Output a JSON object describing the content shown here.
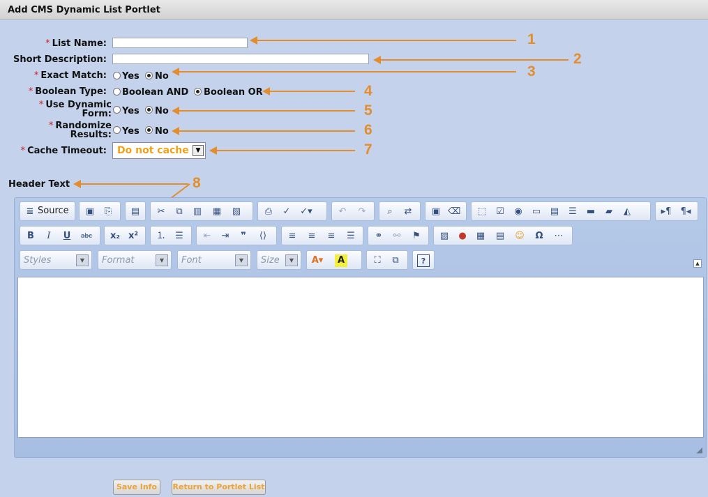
{
  "window": {
    "title": "Add CMS Dynamic List Portlet"
  },
  "form": {
    "required_marker": "*",
    "list_name_label": "List Name:",
    "list_name_value": "",
    "short_desc_label": "Short Description:",
    "short_desc_value": "",
    "exact_match_label": "Exact Match:",
    "boolean_type_label": "Boolean Type:",
    "boolean_and": "Boolean AND",
    "boolean_or": "Boolean OR",
    "dynamic_form_label_1": "Use Dynamic",
    "dynamic_form_label_2": "Form:",
    "randomize_label_1": "Randomize",
    "randomize_label_2": "Results:",
    "yes": "Yes",
    "no": "No",
    "cache_timeout_label": "Cache Timeout:",
    "cache_timeout_value": "Do not cache",
    "header_text_label": "Header Text"
  },
  "callouts": [
    "1",
    "2",
    "3",
    "4",
    "5",
    "6",
    "7",
    "8"
  ],
  "editor": {
    "source_label": "Source",
    "styles_placeholder": "Styles",
    "format_placeholder": "Format",
    "font_placeholder": "Font",
    "size_placeholder": "Size"
  },
  "buttons": {
    "save": "Save Info",
    "return": "Return to Portlet List"
  },
  "colors": {
    "background": "#c4d3eb",
    "accent_orange": "#e38d2c",
    "required_red": "#cc2222"
  }
}
